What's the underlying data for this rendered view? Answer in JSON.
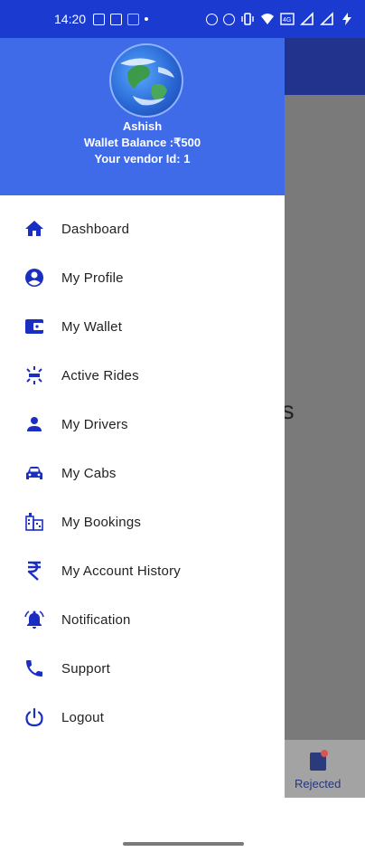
{
  "status_bar": {
    "time": "14:20",
    "colors": {
      "background": "#1a3ad0"
    }
  },
  "drawer": {
    "header": {
      "name": "Ashish",
      "wallet_balance": "Wallet Balance :₹500",
      "vendor_id": "Your vendor Id: 1",
      "colors": {
        "background": "#3f6ae8"
      }
    },
    "menu": [
      {
        "label": "Dashboard",
        "icon": "home-icon"
      },
      {
        "label": "My Profile",
        "icon": "account-circle-icon"
      },
      {
        "label": "My Wallet",
        "icon": "wallet-icon"
      },
      {
        "label": "Active Rides",
        "icon": "active-rides-icon"
      },
      {
        "label": "My Drivers",
        "icon": "person-icon"
      },
      {
        "label": "My Cabs",
        "icon": "car-icon"
      },
      {
        "label": "My Bookings",
        "icon": "bookings-icon"
      },
      {
        "label": "My Account History",
        "icon": "rupee-icon"
      },
      {
        "label": "Notification",
        "icon": "notification-bell-icon"
      },
      {
        "label": "Support",
        "icon": "phone-icon"
      },
      {
        "label": "Logout",
        "icon": "power-icon"
      }
    ],
    "icon_color": "#1a2fc2"
  },
  "background_app": {
    "partial_text": "es",
    "bottom_nav": {
      "rejected_label": "Rejected"
    }
  }
}
